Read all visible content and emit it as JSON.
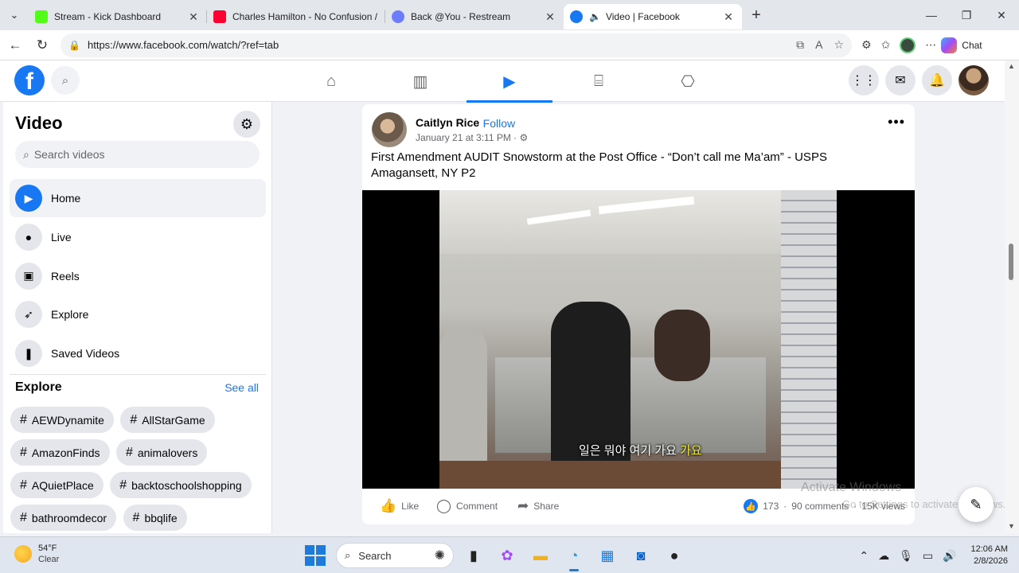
{
  "browser": {
    "tabs": [
      {
        "title": "Stream - Kick Dashboard",
        "favicon_color": "#53fc18",
        "active": false
      },
      {
        "title": "Charles Hamilton - No Confusion /",
        "favicon_color": "#ff0033",
        "active": false
      },
      {
        "title": "Back @You - Restream",
        "favicon_color": "#6b7cff",
        "active": false
      },
      {
        "title": "Video | Facebook",
        "favicon_color": "#1877f2",
        "active": true
      }
    ],
    "url": "https://www.facebook.com/watch/?ref=tab",
    "chat_label": "Chat"
  },
  "sidebar": {
    "title": "Video",
    "search_placeholder": "Search videos",
    "nav": [
      {
        "label": "Home",
        "icon": "play-icon",
        "glyph": "▶",
        "active": true
      },
      {
        "label": "Live",
        "icon": "live-camera-icon",
        "glyph": "●",
        "active": false
      },
      {
        "label": "Reels",
        "icon": "reels-icon",
        "glyph": "▣",
        "active": false
      },
      {
        "label": "Explore",
        "icon": "rocket-icon",
        "glyph": "➶",
        "active": false
      },
      {
        "label": "Saved Videos",
        "icon": "bookmark-icon",
        "glyph": "❚",
        "active": false
      }
    ],
    "explore_title": "Explore",
    "see_all": "See all",
    "hashtags": [
      "AEWDynamite",
      "AllStarGame",
      "AmazonFinds",
      "animalovers",
      "AQuietPlace",
      "backtoschoolshopping",
      "bathroomdecor",
      "bbqlife"
    ]
  },
  "post": {
    "author": "Caitlyn Rice",
    "separator": "·",
    "follow": "Follow",
    "date": "January 21 at 3:11 PM · ⚙",
    "title": "First Amendment AUDIT Snowstorm at the Post Office - “Don’t call me Ma’am” - USPS Amagansett, NY P2",
    "subtitle_main": "일은 뭐야 여기 가요 ",
    "subtitle_highlight": "가요",
    "actions": {
      "like": "Like",
      "comment": "Comment",
      "share": "Share"
    },
    "stats": {
      "reactions": "173",
      "comments": "90 comments",
      "views": "15K views"
    }
  },
  "overlay": {
    "activate_title": "Activate Windows",
    "activate_sub": "Go to Settings to activate Windows."
  },
  "taskbar": {
    "temperature": "54°F",
    "condition": "Clear",
    "search_label": "Search",
    "time": "12:06 AM",
    "date": "2/8/2026"
  }
}
